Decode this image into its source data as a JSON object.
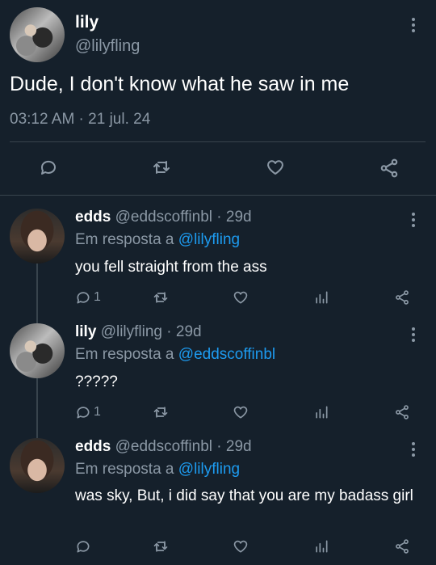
{
  "main": {
    "author_name": "lily",
    "author_handle": "@lilyfling",
    "text": "Dude, I don't know what he saw in me",
    "timestamp": "03:12 AM · 21 jul. 24"
  },
  "reply_prefix": "Em resposta a",
  "replies": [
    {
      "name": "edds",
      "handle": "@eddscoffinbl",
      "age": "· 29d",
      "reply_to": "@lilyfling",
      "text": "you fell straight from the ass",
      "reply_count": "1"
    },
    {
      "name": "lily",
      "handle": "@lilyfling",
      "age": "· 29d",
      "reply_to": "@eddscoffinbl",
      "text": "?????",
      "reply_count": "1"
    },
    {
      "name": "edds",
      "handle": "@eddscoffinbl",
      "age": "· 29d",
      "reply_to": "@lilyfling",
      "text": "was sky, But, i did say that you are my badass girl"
    }
  ],
  "colors": {
    "background": "#15202b",
    "muted": "#8b98a5",
    "link": "#1d9bf0",
    "divider": "#38444d"
  },
  "icons": [
    "reply-icon",
    "retweet-icon",
    "like-icon",
    "views-icon",
    "share-icon",
    "more-options-icon"
  ]
}
